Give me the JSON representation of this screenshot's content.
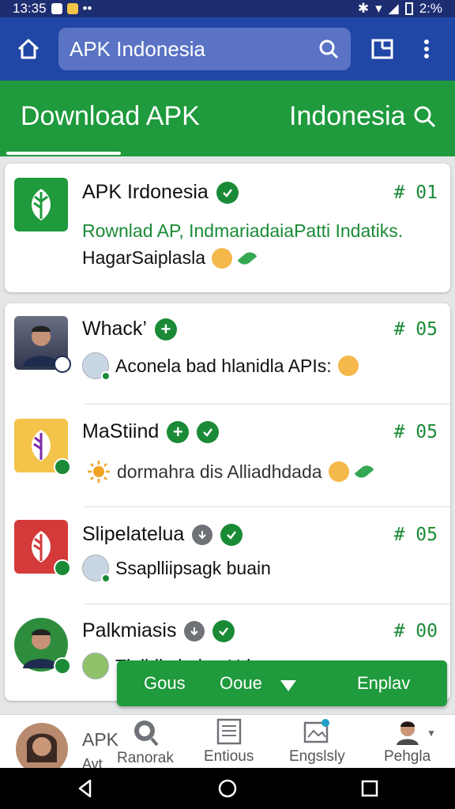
{
  "status_bar": {
    "time": "13:35",
    "battery": "2:%"
  },
  "search": {
    "query": "APK Indonesia"
  },
  "tabs": [
    {
      "label": "Download APK"
    },
    {
      "label": "Indonesia"
    }
  ],
  "featured": {
    "title": "APK Irdonesia",
    "rank": "# 01",
    "subtitle": "Rownlad AP, IndmariadaiaPatti Indatiks.",
    "description": "HagarSaiplasla"
  },
  "apps": [
    {
      "name": "Whack’",
      "rank": "# 05",
      "description": "Aconela bad hlanidla APIs:"
    },
    {
      "name": "MaStiind",
      "rank": "# 05",
      "description": "dormahra dis Alliadhdada"
    },
    {
      "name": "Slipelatelua",
      "rank": "# 05",
      "description": "Ssaplliipsagk buain"
    },
    {
      "name": "Palkmiasis",
      "rank": "# 00",
      "description": "Tlulhlln  lnd  ... Urlr"
    }
  ],
  "action_bar": {
    "items": [
      "Gous",
      "Ooue",
      "Enplav"
    ]
  },
  "bottom_nav": {
    "profile": {
      "title": "APK",
      "sub": "Avt"
    },
    "items": [
      "Ranorak",
      "Entious",
      "Engslsly",
      "Pehgla"
    ]
  },
  "colors": {
    "primary_blue": "#2046a6",
    "primary_green": "#1f9a3d",
    "accent_green": "#1a8a36"
  }
}
